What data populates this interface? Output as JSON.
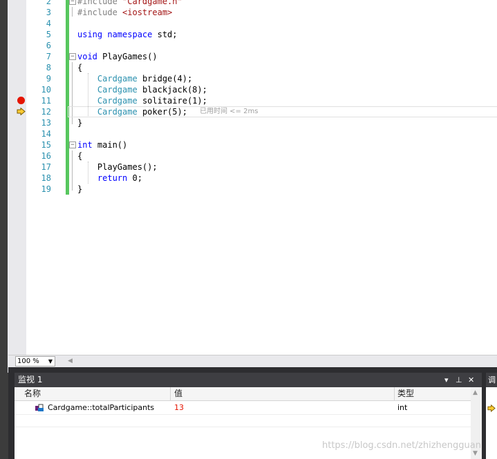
{
  "editor": {
    "lines": [
      {
        "n": "2",
        "segs": [
          {
            "t": "#include ",
            "c": "pre"
          },
          {
            "t": "\"Cardgame.h\"",
            "c": "str"
          }
        ],
        "fold": "⊟"
      },
      {
        "n": "3",
        "segs": [
          {
            "t": "#include ",
            "c": "pre"
          },
          {
            "t": "<iostream>",
            "c": "str"
          }
        ]
      },
      {
        "n": "4",
        "segs": []
      },
      {
        "n": "5",
        "segs": [
          {
            "t": "using ",
            "c": "kw"
          },
          {
            "t": "namespace ",
            "c": "kw"
          },
          {
            "t": "std;",
            "c": ""
          }
        ]
      },
      {
        "n": "6",
        "segs": []
      },
      {
        "n": "7",
        "segs": [
          {
            "t": "void ",
            "c": "kw"
          },
          {
            "t": "PlayGames()",
            "c": ""
          }
        ],
        "fold": "⊟"
      },
      {
        "n": "8",
        "segs": [
          {
            "t": "{",
            "c": ""
          }
        ]
      },
      {
        "n": "9",
        "segs": [
          {
            "t": "    ",
            "c": ""
          },
          {
            "t": "Cardgame ",
            "c": "ty"
          },
          {
            "t": "bridge(4);",
            "c": ""
          }
        ]
      },
      {
        "n": "10",
        "segs": [
          {
            "t": "    ",
            "c": ""
          },
          {
            "t": "Cardgame ",
            "c": "ty"
          },
          {
            "t": "blackjack(8);",
            "c": ""
          }
        ]
      },
      {
        "n": "11",
        "segs": [
          {
            "t": "    ",
            "c": ""
          },
          {
            "t": "Cardgame ",
            "c": "ty"
          },
          {
            "t": "solitaire(1);",
            "c": ""
          }
        ]
      },
      {
        "n": "12",
        "segs": [
          {
            "t": "    ",
            "c": ""
          },
          {
            "t": "Cardgame ",
            "c": "ty"
          },
          {
            "t": "poker(5);",
            "c": ""
          }
        ]
      },
      {
        "n": "13",
        "segs": [
          {
            "t": "}",
            "c": ""
          }
        ]
      },
      {
        "n": "14",
        "segs": []
      },
      {
        "n": "15",
        "segs": [
          {
            "t": "int ",
            "c": "kw"
          },
          {
            "t": "main()",
            "c": ""
          }
        ],
        "fold": "⊟"
      },
      {
        "n": "16",
        "segs": [
          {
            "t": "{",
            "c": ""
          }
        ]
      },
      {
        "n": "17",
        "segs": [
          {
            "t": "    PlayGames();",
            "c": ""
          }
        ]
      },
      {
        "n": "18",
        "segs": [
          {
            "t": "    ",
            "c": ""
          },
          {
            "t": "return ",
            "c": "kw"
          },
          {
            "t": "0;",
            "c": ""
          }
        ]
      },
      {
        "n": "19",
        "segs": [
          {
            "t": "}",
            "c": ""
          }
        ]
      }
    ],
    "perf_tip": "已用时间 <= 2ms",
    "breakpoint_line": "11",
    "current_line": "12"
  },
  "zoom": {
    "value": "100 %"
  },
  "watch": {
    "title": "监视 1",
    "columns": {
      "name": "名称",
      "value": "值",
      "type": "类型"
    },
    "rows": [
      {
        "name": "Cardgame::totalParticipants",
        "value": "13",
        "type": "int",
        "value_color": "#e51400"
      }
    ]
  },
  "right_panel": {
    "title": "调"
  },
  "watermark": "https://blog.csdn.net/zhizhengguan"
}
